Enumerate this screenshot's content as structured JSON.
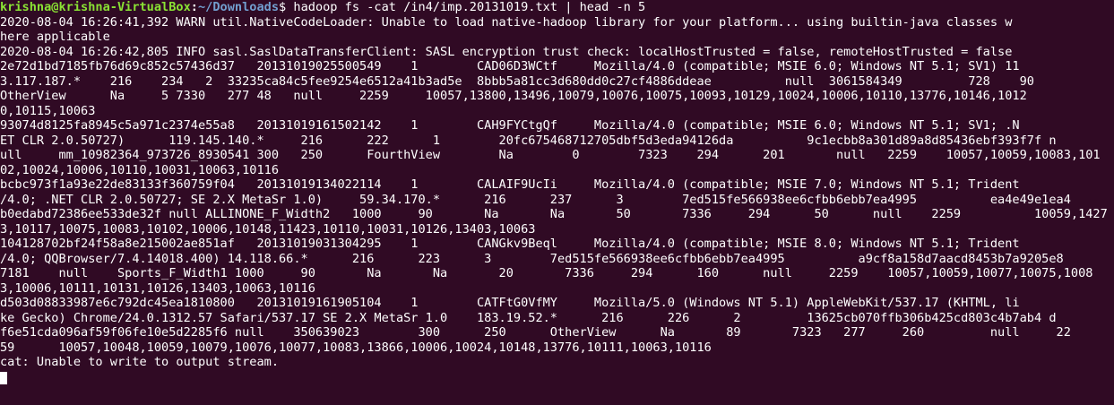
{
  "prompt": {
    "user_host": "krishna@krishna-VirtualBox",
    "separator": ":",
    "path": "~/Downloads",
    "symbol": "$ ",
    "command": "hadoop fs -cat /in4/imp.20131019.txt | head -n 5"
  },
  "output_lines": [
    "2020-08-04 16:26:41,392 WARN util.NativeCodeLoader: Unable to load native-hadoop library for your platform... using builtin-java classes w",
    "here applicable",
    "2020-08-04 16:26:42,805 INFO sasl.SaslDataTransferClient: SASL encryption trust check: localHostTrusted = false, remoteHostTrusted = false",
    "2e72d1bd7185fb76d69c852c57436d37   20131019025500549    1        CAD06D3WCtf     Mozilla/4.0 (compatible; MSIE 6.0; Windows NT 5.1; SV1) 11",
    "3.117.187.*    216    234   2  33235ca84c5fee9254e6512a41b3ad5e  8bbb5a81cc3d680dd0c27cf4886ddeae          null  3061584349         728    90",
    "OtherView      Na     5 7330   277 48   null     2259     10057,13800,13496,10079,10076,10075,10093,10129,10024,10006,10110,13776,10146,1012",
    "0,10115,10063",
    "93074d8125fa8945c5a971c2374e55a8   20131019161502142    1        CAH9FYCtgQf     Mozilla/4.0 (compatible; MSIE 6.0; Windows NT 5.1; SV1; .N",
    "ET CLR 2.0.50727)      119.145.140.*     216      222      1        20fc675468712705dbf5d3eda94126da          9c1ecbb8a301d89a8d85436ebf393f7f n",
    "ull     mm_10982364_973726_8930541 300   250      FourthView        Na        0        7323    294      201       null   2259    10057,10059,10083,101",
    "02,10024,10006,10110,10031,10063,10116",
    "bcbc973f1a93e22de83133f360759f04   20131019134022114    1        CALAIF9UcIi     Mozilla/4.0 (compatible; MSIE 7.0; Windows NT 5.1; Trident",
    "/4.0; .NET CLR 2.0.50727; SE 2.X MetaSr 1.0)     59.34.170.*      216      237      3        7ed515fe566938ee6cfbb6ebb7ea4995          ea4e49e1ea4",
    "b0edabd72386ee533de32f null ALLINONE_F_Width2   1000     90       Na       Na       50       7336     294      50      null    2259          10059,1427",
    "3,10117,10075,10083,10102,10006,10148,11423,10110,10031,10126,13403,10063",
    "104128702bf24f58a8e215002ae851af   20131019031304295    1        CANGkv9Beql     Mozilla/4.0 (compatible; MSIE 8.0; Windows NT 5.1; Trident",
    "/4.0; QQBrowser/7.4.14018.400) 14.118.66.*      216      223      3        7ed515fe566938ee6cfbb6ebb7ea4995          a9cf8a158d7aacd8453b7a9205e8",
    "7181    null    Sports_F_Width1 1000     90       Na       Na       20       7336     294      160      null     2259    10057,10059,10077,10075,1008",
    "3,10006,10111,10131,10126,13403,10063,10116",
    "d503d08833987e6c792dc45ea1810800   20131019161905104    1        CATFtG0VfMY     Mozilla/5.0 (Windows NT 5.1) AppleWebKit/537.17 (KHTML, li",
    "ke Gecko) Chrome/24.0.1312.57 Safari/537.17 SE 2.X MetaSr 1.0    183.19.52.*      216      226      2         13625cb070ffb306b425cd803c4b7ab4 d",
    "f6e51cda096af59f06fe10e5d2285f6 null    350639023        300      250      OtherView      Na       89       7323   277     260         null     22",
    "59      10057,10048,10059,10079,10076,10077,10083,13866,10006,10024,10148,13776,10111,10063,10116",
    "cat: Unable to write to output stream."
  ]
}
